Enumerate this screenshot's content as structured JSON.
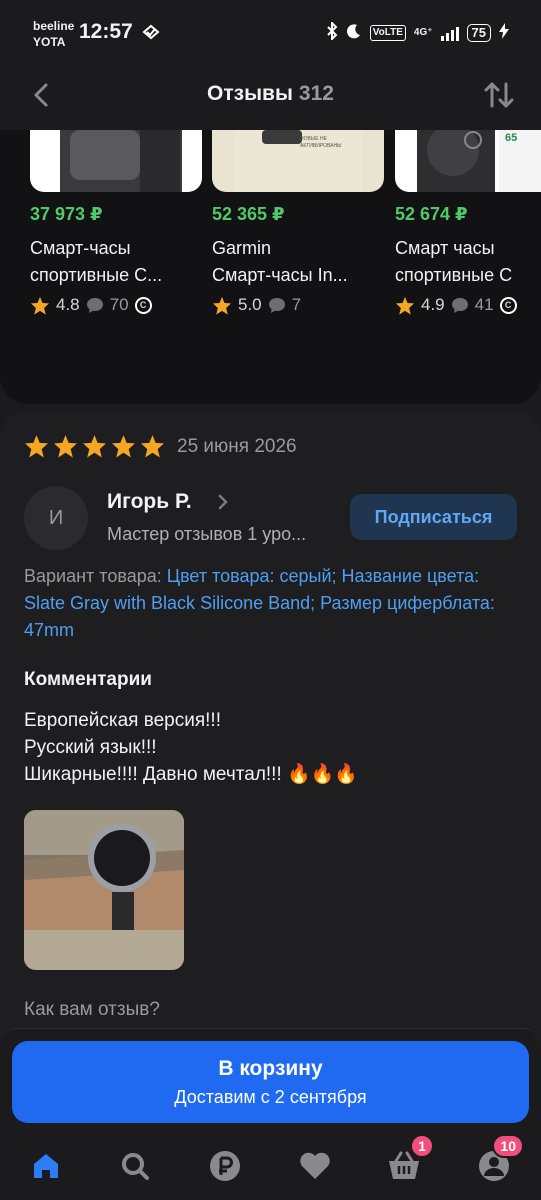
{
  "status_bar": {
    "carrier_1": "beeline",
    "carrier_2": "YOTA",
    "time": "12:57",
    "volte": "VoLTE",
    "net": "4G⁺",
    "battery": "75"
  },
  "header": {
    "title": "Отзывы",
    "count": "312"
  },
  "products": [
    {
      "price": "37 973 ₽",
      "name": "Смарт-часы спортивные С...",
      "rating": "4.8",
      "reviews": "70",
      "img_text": ""
    },
    {
      "price": "52 365 ₽",
      "name": "Garmin Смарт-часы In...",
      "rating": "5.0",
      "reviews": "7",
      "img_text": "НОВЫЕ НЕ АКТИВИРОВАНЫ"
    },
    {
      "price": "52 674 ₽",
      "name": "Смарт часы спортивные С...",
      "rating": "4.9",
      "reviews": "41",
      "img_text": "65"
    }
  ],
  "product_names_split": [
    {
      "l1": "Смарт-часы",
      "l2": "спортивные С..."
    },
    {
      "l1": "Garmin",
      "l2": "Смарт-часы In..."
    },
    {
      "l1": "Смарт часы",
      "l2": "спортивные С"
    }
  ],
  "review": {
    "stars": 5,
    "date": "25 июня 2026",
    "avatar_letter": "И",
    "author": "Игорь Р.",
    "rank": "Мастер отзывов 1 уро...",
    "subscribe_label": "Подписаться",
    "variant_label": "Вариант товара:",
    "variant_value": "Цвет товара: серый; Название цвета: Slate Gray with Black Silicone Band; Размер циферблата: 47mm",
    "comments_heading": "Комментарии",
    "comment_text": "Европейская версия!!!\nРусский язык!!!\nШикарные!!!! Давно мечтал!!! 🔥🔥🔥",
    "ask": "Как вам отзыв?"
  },
  "cta": {
    "label": "В корзину",
    "delivery": "Доставим с 2 сентября"
  },
  "tabbar": {
    "cart_badge": "1",
    "profile_badge": "10"
  },
  "colors": {
    "accent": "#1f6af0",
    "price": "#52c86c",
    "star": "#f5a623",
    "link": "#4f9ef0",
    "badge": "#f14d7d"
  }
}
